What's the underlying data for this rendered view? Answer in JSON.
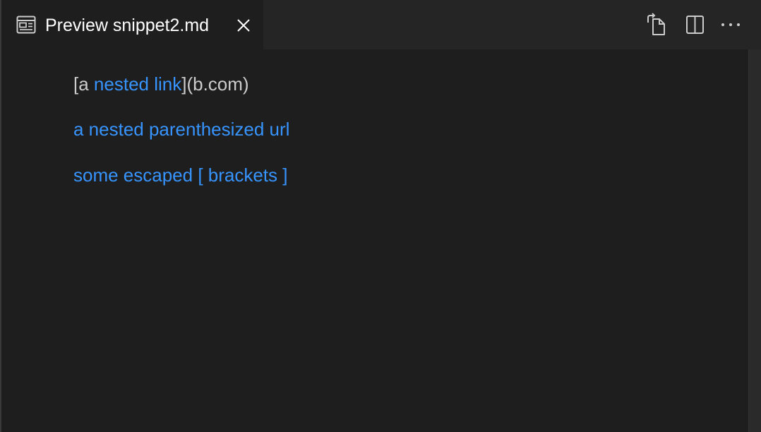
{
  "tab": {
    "title": "Preview snippet2.md",
    "icon": "preview-icon"
  },
  "actions": [
    {
      "name": "open-source-icon"
    },
    {
      "name": "split-editor-icon"
    },
    {
      "name": "more-actions-icon"
    }
  ],
  "content": {
    "paragraph1": {
      "prefix": "[a ",
      "link": "nested link",
      "suffix": "](b.com)"
    },
    "paragraph2": {
      "link": "a nested parenthesized url"
    },
    "paragraph3": {
      "link": "some escaped [ brackets ]"
    }
  },
  "colors": {
    "background": "#1e1e1e",
    "tabbar": "#252526",
    "link": "#3794ff",
    "text": "#cccccc"
  }
}
